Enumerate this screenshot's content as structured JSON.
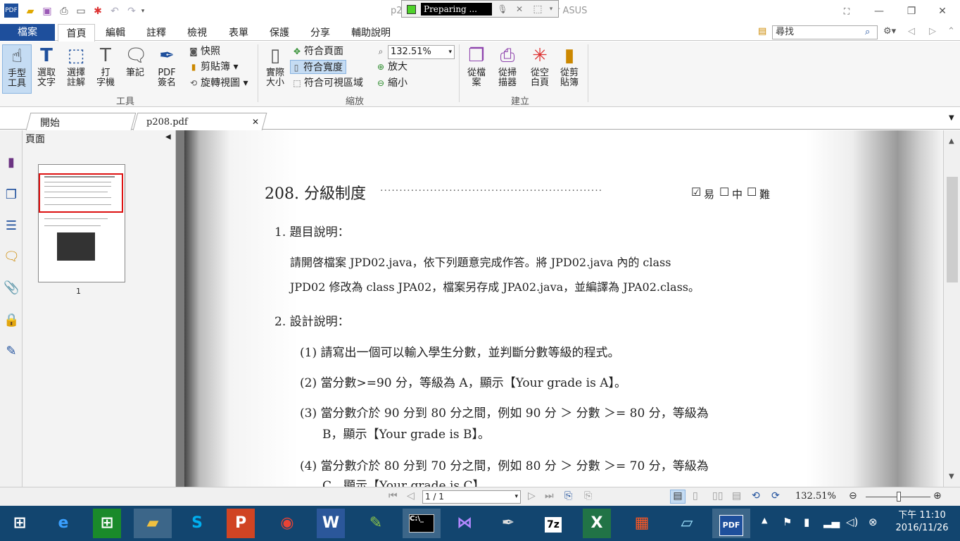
{
  "titlebar": {
    "title_left": "p2",
    "title_right": "r ASUS",
    "recorder_status": "Preparing ...",
    "recorder_color": "#4fd32b"
  },
  "menubar": {
    "file_tab": "檔案",
    "tabs": [
      "首頁",
      "編輯",
      "註釋",
      "檢視",
      "表單",
      "保護",
      "分享",
      "輔助說明"
    ],
    "search_value": "尋找"
  },
  "ribbon": {
    "tools": {
      "hand": "手型\n工具",
      "select_text": "選取\n文字",
      "select_annot": "選擇\n註解",
      "typewriter": "打\n字機",
      "note": "筆記",
      "pdf_sign": "PDF\n簽名",
      "snapshot": "快照",
      "clipboard": "剪貼簿",
      "rotate": "旋轉視圖",
      "group_label": "工具"
    },
    "zoom": {
      "actual_size": "實際\n大小",
      "fit_page": "符合頁面",
      "fit_width": "符合寬度",
      "fit_visible": "符合可視區域",
      "zoom_value": "132.51%",
      "zoom_in": "放大",
      "zoom_out": "縮小",
      "group_label": "縮放"
    },
    "create": {
      "from_file": "從檔\n案",
      "from_scanner": "從掃\n描器",
      "from_blank": "從空\n白頁",
      "from_clipboard": "從剪\n貼簿",
      "group_label": "建立"
    }
  },
  "doctabs": {
    "start": "開始",
    "file": "p208.pdf"
  },
  "pages_panel": {
    "header": "頁面",
    "thumb_number": "1"
  },
  "document": {
    "title": "208. 分級制度",
    "difficulty_easy": "易",
    "difficulty_mid": "中",
    "difficulty_hard": "難",
    "section1": "1. 題目說明：",
    "para1_line1": "請開啓檔案 JPD02.java，依下列題意完成作答。將 JPD02.java 內的 class",
    "para1_line2": "JPD02 修改為 class JPA02，檔案另存成 JPA02.java，並編譯為 JPA02.class。",
    "section2": "2. 設計說明：",
    "item1": "(1) 請寫出一個可以輸入學生分數，並判斷分數等級的程式。",
    "item2": "(2) 當分數>=90 分，等級為 A，顯示【Your grade is A】。",
    "item3_line1": "(3) 當分數介於 90 分到 80 分之間，例如 90 分 ＞ 分數 ＞= 80 分，等級為",
    "item3_line2": "B，顯示【Your grade is B】。",
    "item4_line1": "(4) 當分數介於 80 分到 70 分之間，例如 80 分 ＞ 分數 ＞= 70 分，等級為",
    "item4_line2": "C，顯示【Your grade is C】。"
  },
  "statusbar": {
    "page_value": "1 / 1",
    "zoom_pct": "132.51%"
  },
  "taskbar": {
    "clock_line1": "下午 11:10",
    "clock_line2": "2016/11/26",
    "bg_color": "#12456f"
  }
}
